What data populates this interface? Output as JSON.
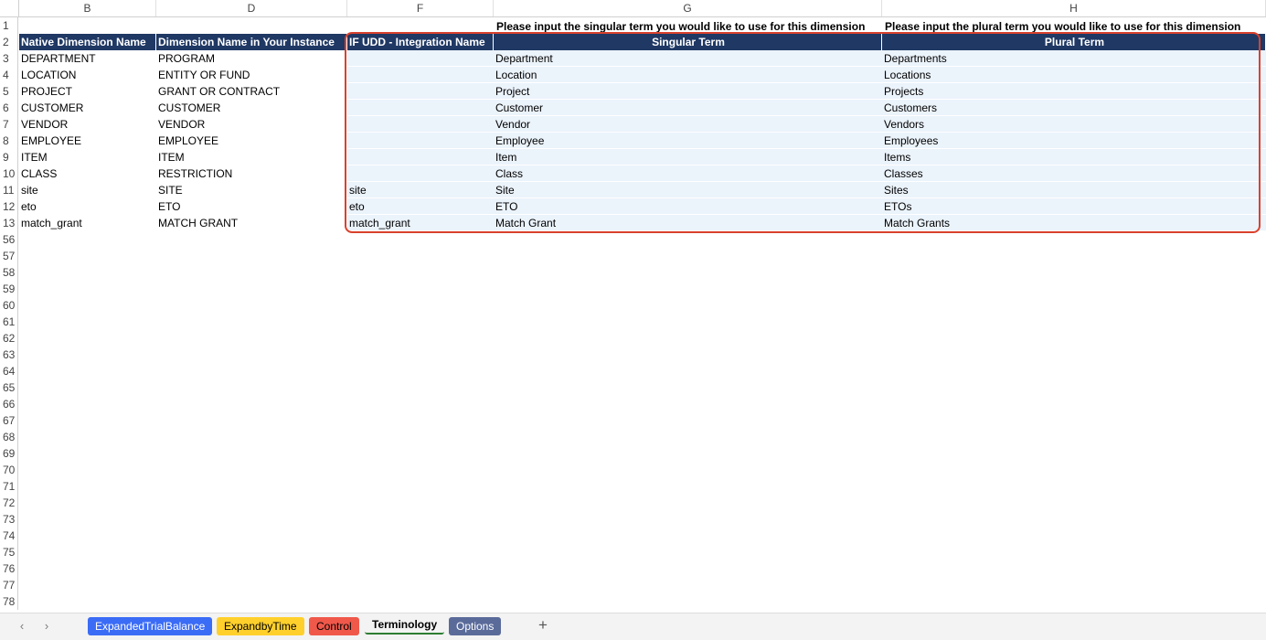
{
  "columns": [
    {
      "key": "B",
      "label": "B"
    },
    {
      "key": "D",
      "label": "D"
    },
    {
      "key": "F",
      "label": "F"
    },
    {
      "key": "G",
      "label": "G"
    },
    {
      "key": "H",
      "label": "H"
    }
  ],
  "notes": {
    "G": "Please input the singular term you would like to use for this dimension",
    "H": "Please input the plural term you would like to use for this dimension"
  },
  "headers": {
    "B": "Native Dimension Name",
    "D": "Dimension Name in Your Instance",
    "F": "IF UDD - Integration Name",
    "G": "Singular Term",
    "H": "Plural Term"
  },
  "row_numbers_top": [
    "1",
    "2"
  ],
  "rows": [
    {
      "num": "3",
      "B": "DEPARTMENT",
      "D": "PROGRAM",
      "F": "",
      "G": "Department",
      "H": "Departments"
    },
    {
      "num": "4",
      "B": "LOCATION",
      "D": "ENTITY OR FUND",
      "F": "",
      "G": "Location",
      "H": "Locations"
    },
    {
      "num": "5",
      "B": "PROJECT",
      "D": "GRANT OR CONTRACT",
      "F": "",
      "G": "Project",
      "H": "Projects"
    },
    {
      "num": "6",
      "B": "CUSTOMER",
      "D": "CUSTOMER",
      "F": "",
      "G": "Customer",
      "H": "Customers"
    },
    {
      "num": "7",
      "B": "VENDOR",
      "D": "VENDOR",
      "F": "",
      "G": "Vendor",
      "H": "Vendors"
    },
    {
      "num": "8",
      "B": "EMPLOYEE",
      "D": "EMPLOYEE",
      "F": "",
      "G": "Employee",
      "H": "Employees"
    },
    {
      "num": "9",
      "B": "ITEM",
      "D": "ITEM",
      "F": "",
      "G": "Item",
      "H": "Items"
    },
    {
      "num": "10",
      "B": "CLASS",
      "D": "RESTRICTION",
      "F": "",
      "G": "Class",
      "H": "Classes"
    },
    {
      "num": "11",
      "B": "site",
      "D": "SITE",
      "F": "site",
      "G": "Site",
      "H": "Sites"
    },
    {
      "num": "12",
      "B": "eto",
      "D": "ETO",
      "F": "eto",
      "G": "ETO",
      "H": "ETOs"
    },
    {
      "num": "13",
      "B": "match_grant",
      "D": "MATCH GRANT",
      "F": "match_grant",
      "G": "Match Grant",
      "H": "Match Grants"
    }
  ],
  "empty_row_numbers": [
    "56",
    "57",
    "58",
    "59",
    "60",
    "61",
    "62",
    "63",
    "64",
    "65",
    "66",
    "67",
    "68",
    "69",
    "70",
    "71",
    "72",
    "73",
    "74",
    "75",
    "76",
    "77",
    "78"
  ],
  "tabs": [
    {
      "label": "ExpandedTrialBalance",
      "color": "#3b6cf6",
      "text_color": "#ffffff"
    },
    {
      "label": "ExpandbyTime",
      "color": "#ffd02b",
      "text_color": "#000000"
    },
    {
      "label": "Control",
      "color": "#f0584a",
      "text_color": "#000000"
    },
    {
      "label": "Terminology",
      "color": "",
      "text_color": "#000000",
      "active": true
    },
    {
      "label": "Options",
      "color": "#5a6b9a",
      "text_color": "#ffffff"
    }
  ],
  "tabbar": {
    "prev_icon": "chevron-left-icon",
    "next_icon": "chevron-right-icon",
    "add_icon": "plus-icon",
    "prev": "‹",
    "next": "›",
    "add": "+"
  },
  "colors": {
    "header_fill": "#1f3864",
    "band_fill": "#ebf3fb",
    "highlight": "#d9412c"
  }
}
